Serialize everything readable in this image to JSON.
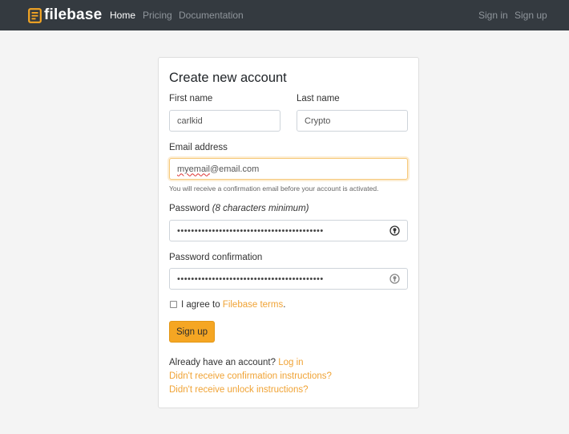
{
  "navbar": {
    "brand": "filebase",
    "links": [
      "Home",
      "Pricing",
      "Documentation"
    ],
    "right_links": [
      "Sign in",
      "Sign up"
    ],
    "brand_color": "#f5a623",
    "bg_color": "#343a40"
  },
  "form": {
    "title": "Create new account",
    "first_name": {
      "label": "First name",
      "value": "carlkid"
    },
    "last_name": {
      "label": "Last name",
      "value": "Crypto"
    },
    "email": {
      "label": "Email address",
      "value_underlined": "myemail",
      "value_rest": "@email.com",
      "help": "You will receive a confirmation email before your account is activated."
    },
    "password": {
      "label": "Password",
      "hint": "(8 characters minimum)",
      "masked": "••••••••••••••••••••••••••••••••••••••••••"
    },
    "password_confirmation": {
      "label": "Password confirmation",
      "masked": "••••••••••••••••••••••••••••••••••••••••••"
    },
    "terms": {
      "prefix": "I agree to",
      "link": "Filebase terms",
      "suffix": "."
    },
    "submit": "Sign up",
    "footer": {
      "have_account": "Already have an account?",
      "login_link": "Log in",
      "confirmation_link": "Didn't receive confirmation instructions?",
      "unlock_link": "Didn't receive unlock instructions?"
    }
  },
  "icons": {
    "logo": "filebase-logo-icon",
    "password_toggle": "eye-icon"
  }
}
